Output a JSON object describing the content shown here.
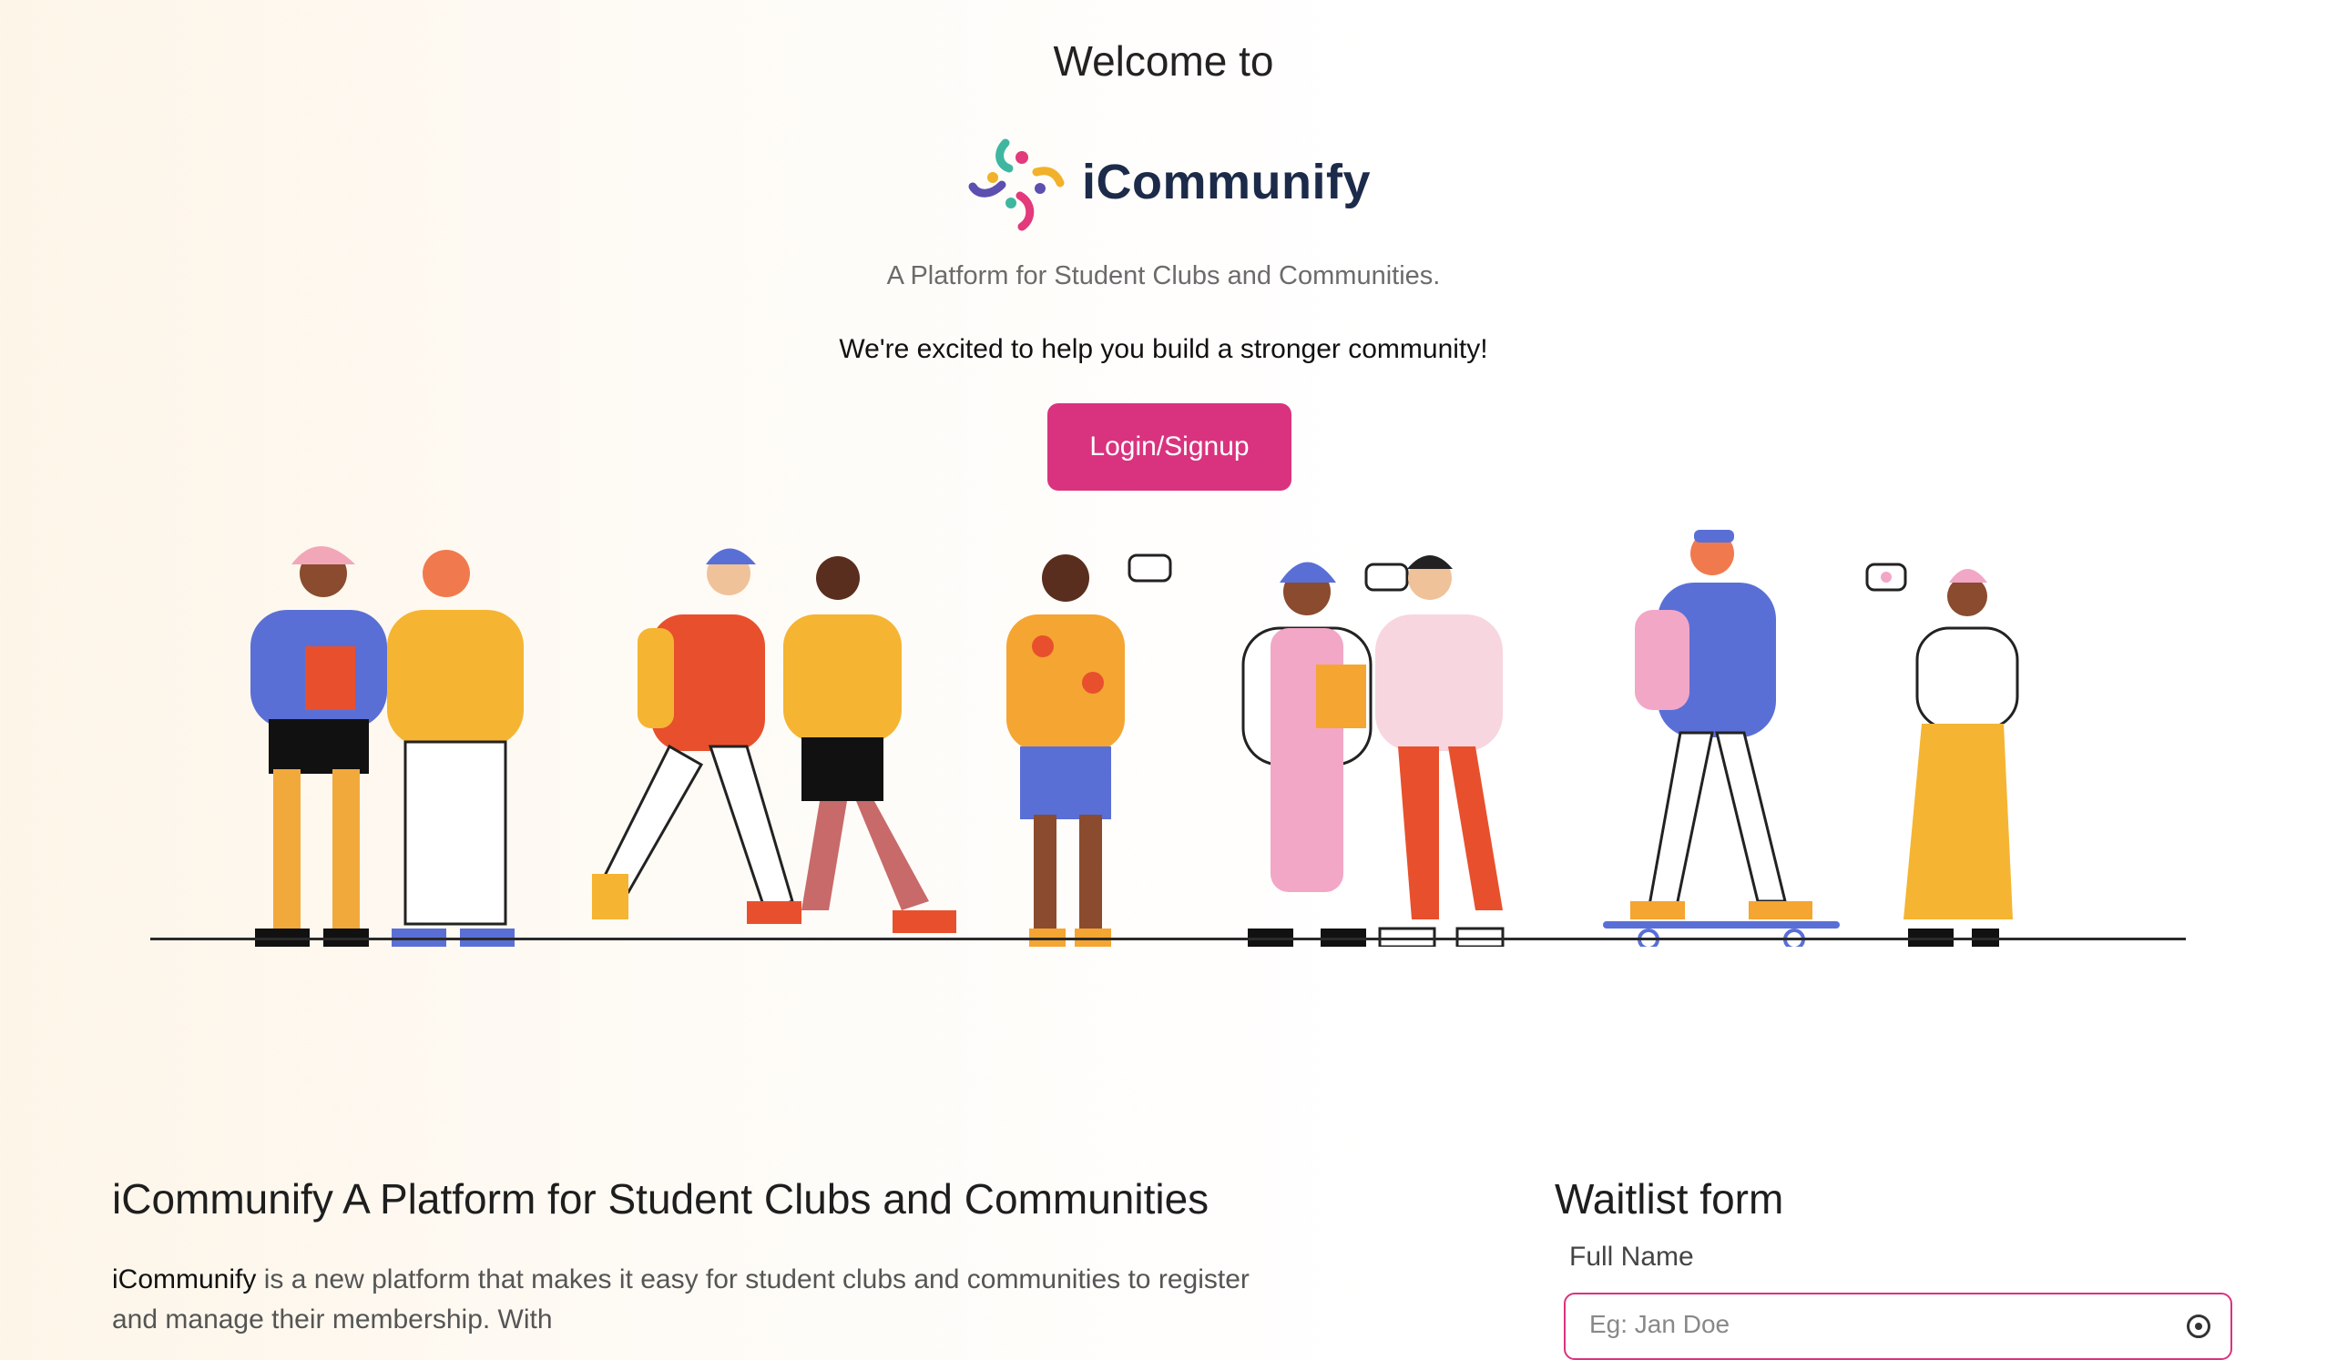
{
  "hero": {
    "welcome": "Welcome to",
    "brand_name": "iCommunify",
    "tagline": "A Platform for Student Clubs and Communities.",
    "excited": "We're excited to help you build a stronger community!",
    "cta_label": "Login/Signup"
  },
  "illustration": {
    "icon": "people-community-illustration",
    "speech_icons": [
      "ellipsis-bubble-icon",
      "mail-bubble-icon",
      "heart-bubble-icon"
    ]
  },
  "about": {
    "title": "iCommunify A Platform for Student Clubs and Communities",
    "lead_brand": "iCommunify",
    "body": " is a new platform that makes it easy for student clubs and communities to register and manage their membership. With"
  },
  "waitlist": {
    "title": "Waitlist form",
    "full_name_label": "Full Name",
    "full_name_placeholder": "Eg: Jan Doe"
  },
  "colors": {
    "accent": "#d9337f",
    "brand_text": "#1d2b4a",
    "logo_purple": "#5c4fb0",
    "logo_yellow": "#f2b12a",
    "logo_teal": "#3fb7a0",
    "logo_pink": "#e23a7a"
  }
}
